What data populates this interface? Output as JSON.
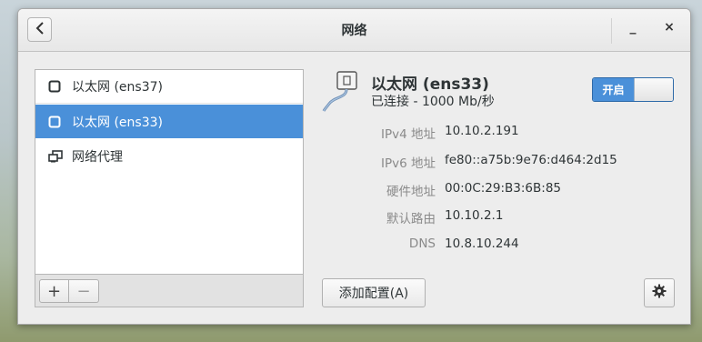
{
  "window": {
    "title": "网络",
    "back_icon": "chevron-left-icon",
    "minimize_label": "_",
    "close_label": "×"
  },
  "connections": [
    {
      "label": "以太网 (ens37)",
      "icon": "ethernet-icon",
      "selected": false
    },
    {
      "label": "以太网 (ens33)",
      "icon": "ethernet-icon",
      "selected": true
    },
    {
      "label": "网络代理",
      "icon": "proxy-icon",
      "selected": false
    }
  ],
  "list_toolbar": {
    "add_label": "+",
    "remove_label": "−"
  },
  "device": {
    "name": "以太网 (ens33)",
    "status": "已连接 - 1000 Mb/秒",
    "switch_label": "开启",
    "switch_on": true
  },
  "details": [
    {
      "label": "IPv4 地址",
      "value": "10.10.2.191"
    },
    {
      "label": "IPv6 地址",
      "value": "fe80::a75b:9e76:d464:2d15"
    },
    {
      "label": "硬件地址",
      "value": "00:0C:29:B3:6B:85"
    },
    {
      "label": "默认路由",
      "value": "10.10.2.1"
    },
    {
      "label": "DNS",
      "value": "10.8.10.244"
    }
  ],
  "actions": {
    "add_profile_label": "添加配置(A)",
    "settings_icon": "gear-icon"
  },
  "colors": {
    "accent": "#4a90d9"
  }
}
